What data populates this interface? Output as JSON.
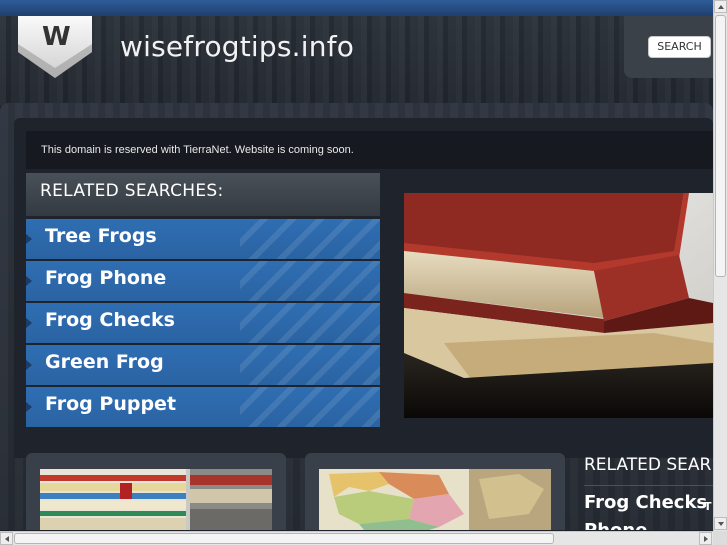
{
  "header": {
    "logo_letter": "W",
    "site_title": "wisefrogtips.info",
    "search_label": "SEARCH"
  },
  "notice": "This domain is reserved with TierraNet. Website is coming soon.",
  "related": {
    "heading": "RELATED SEARCHES:",
    "items": [
      {
        "label": "Tree Frogs"
      },
      {
        "label": "Frog Phone"
      },
      {
        "label": "Frog Checks"
      },
      {
        "label": "Green Frog"
      },
      {
        "label": "Frog Puppet"
      }
    ]
  },
  "right_column": {
    "heading": "RELATED SEAR",
    "links": [
      {
        "label": "Frog Checks",
        "suffix": "T"
      },
      {
        "label": "Phone ",
        "suffix": "C"
      }
    ]
  },
  "colors": {
    "accent_blue": "#2f6eb3",
    "background": "#1c2129",
    "top_strip": "#2f5c99"
  },
  "icons": {
    "logo": "w-shield-logo",
    "list_marker": "triangle-right-icon"
  }
}
